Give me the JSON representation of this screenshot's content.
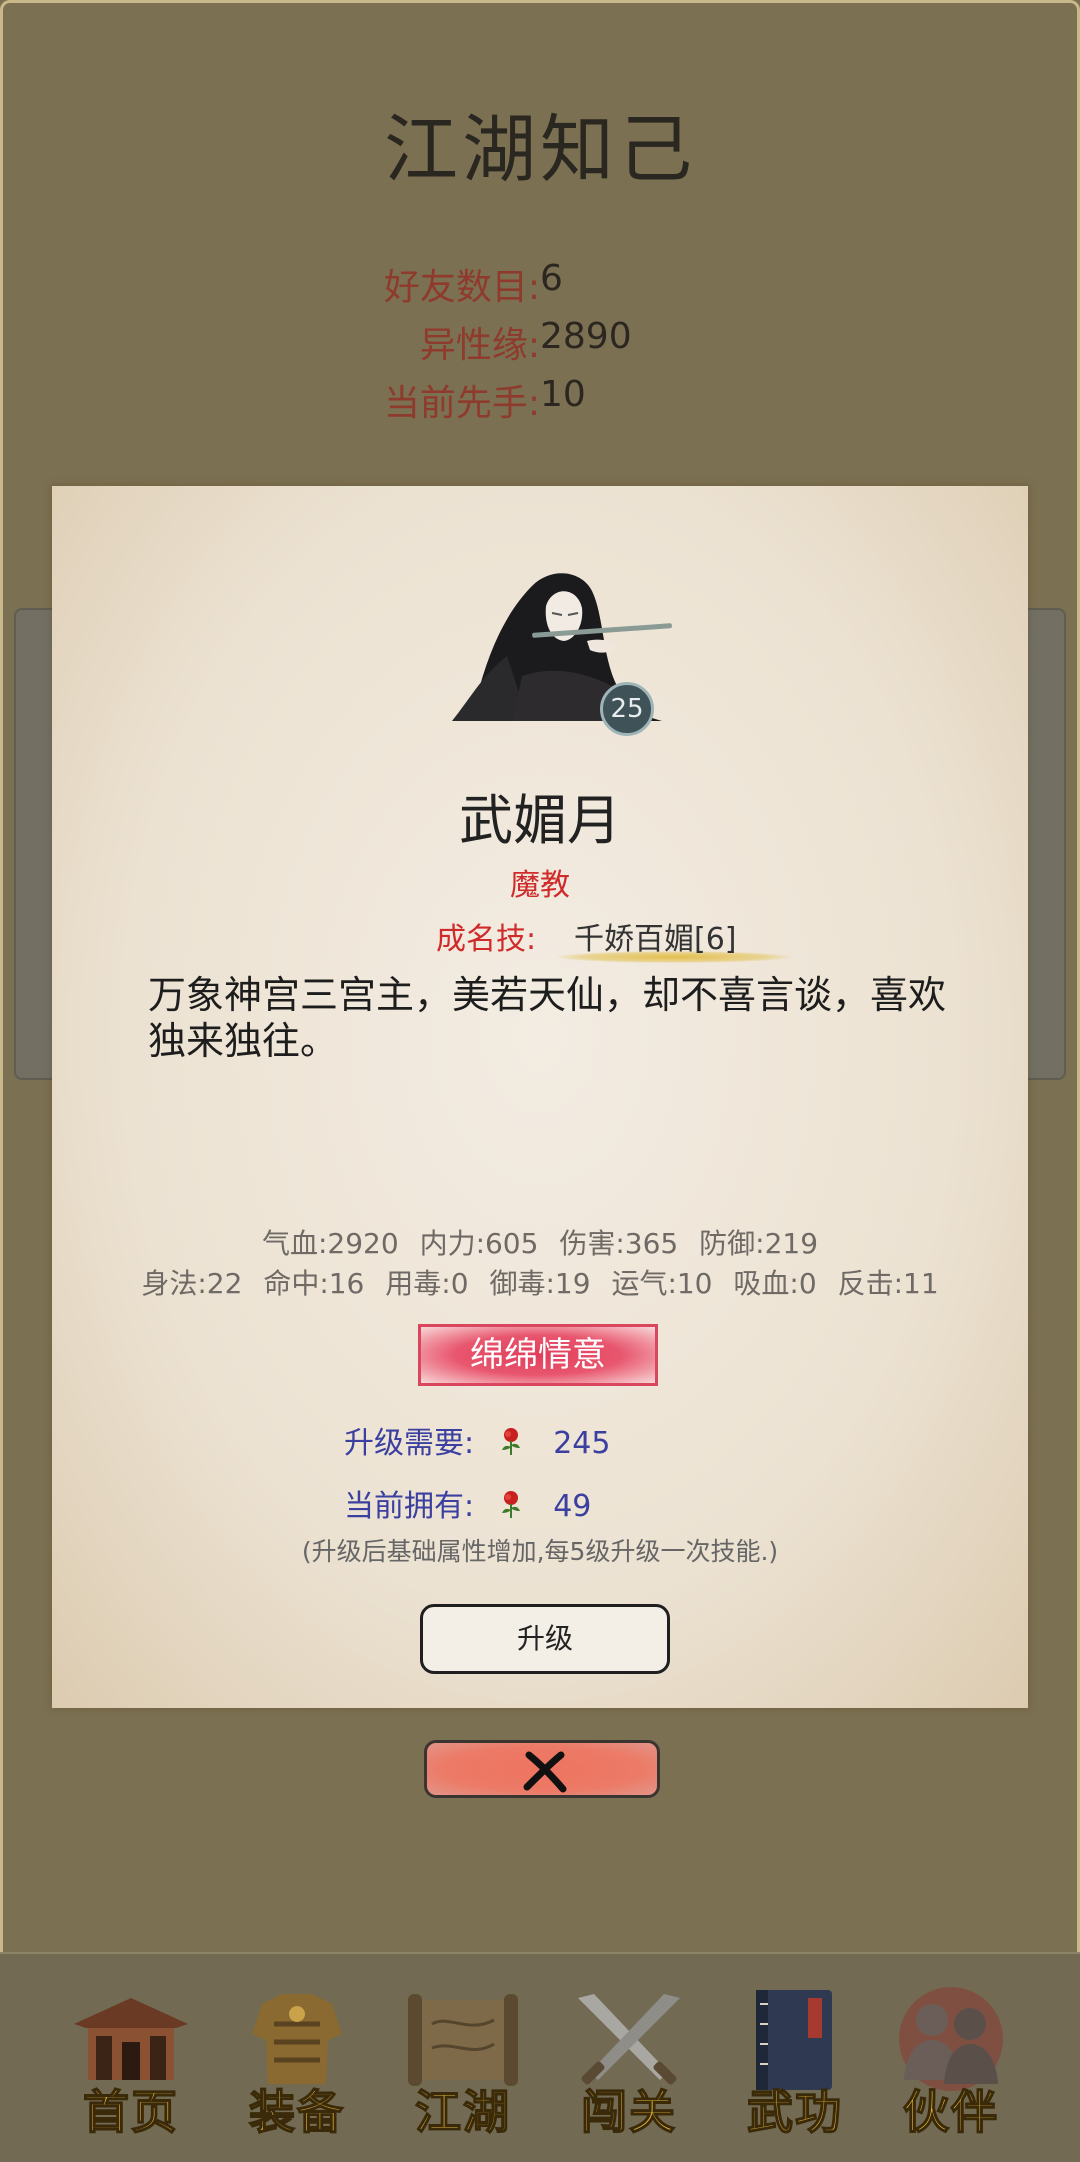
{
  "header": {
    "title": "江湖知己"
  },
  "stats": [
    {
      "label": "好友数目:",
      "value": "6"
    },
    {
      "label": "异性缘:",
      "value": "2890"
    },
    {
      "label": "当前先手:",
      "value": "10"
    }
  ],
  "character": {
    "level": "25",
    "name": "武媚月",
    "sect": "魔教",
    "skill_label": "成名技:",
    "skill_name": "千娇百媚[6]",
    "description": "万象神宫三宫主，美若天仙，却不喜言谈，喜欢独来独往。",
    "attributes_row1": [
      "气血:2920",
      "内力:605",
      "伤害:365",
      "防御:219"
    ],
    "attributes_row2": [
      "身法:22",
      "命中:16",
      "用毒:0",
      "御毒:19",
      "运气:10",
      "吸血:0",
      "反击:11"
    ],
    "title_badge": "绵绵情意"
  },
  "upgrade": {
    "required_label": "升级需要:",
    "required_value": "245",
    "owned_label": "当前拥有:",
    "owned_value": "49",
    "currency_icon": "rose-icon",
    "note": "(升级后基础属性增加,每5级升级一次技能.)",
    "button_label": "升级"
  },
  "close_icon": "close-x-icon",
  "nav": [
    {
      "label": "首页",
      "icon": "house-icon"
    },
    {
      "label": "装备",
      "icon": "armor-icon"
    },
    {
      "label": "江湖",
      "icon": "scroll-icon"
    },
    {
      "label": "闯关",
      "icon": "crossed-swords-icon"
    },
    {
      "label": "武功",
      "icon": "book-icon"
    },
    {
      "label": "伙伴",
      "icon": "partners-icon"
    }
  ],
  "colors": {
    "background": "#7c7052",
    "stat_label": "#8e3a2c",
    "sect_red": "#d02a2a",
    "upgrade_blue": "#3a3fa0",
    "nav_gold": "#e0b43a"
  }
}
